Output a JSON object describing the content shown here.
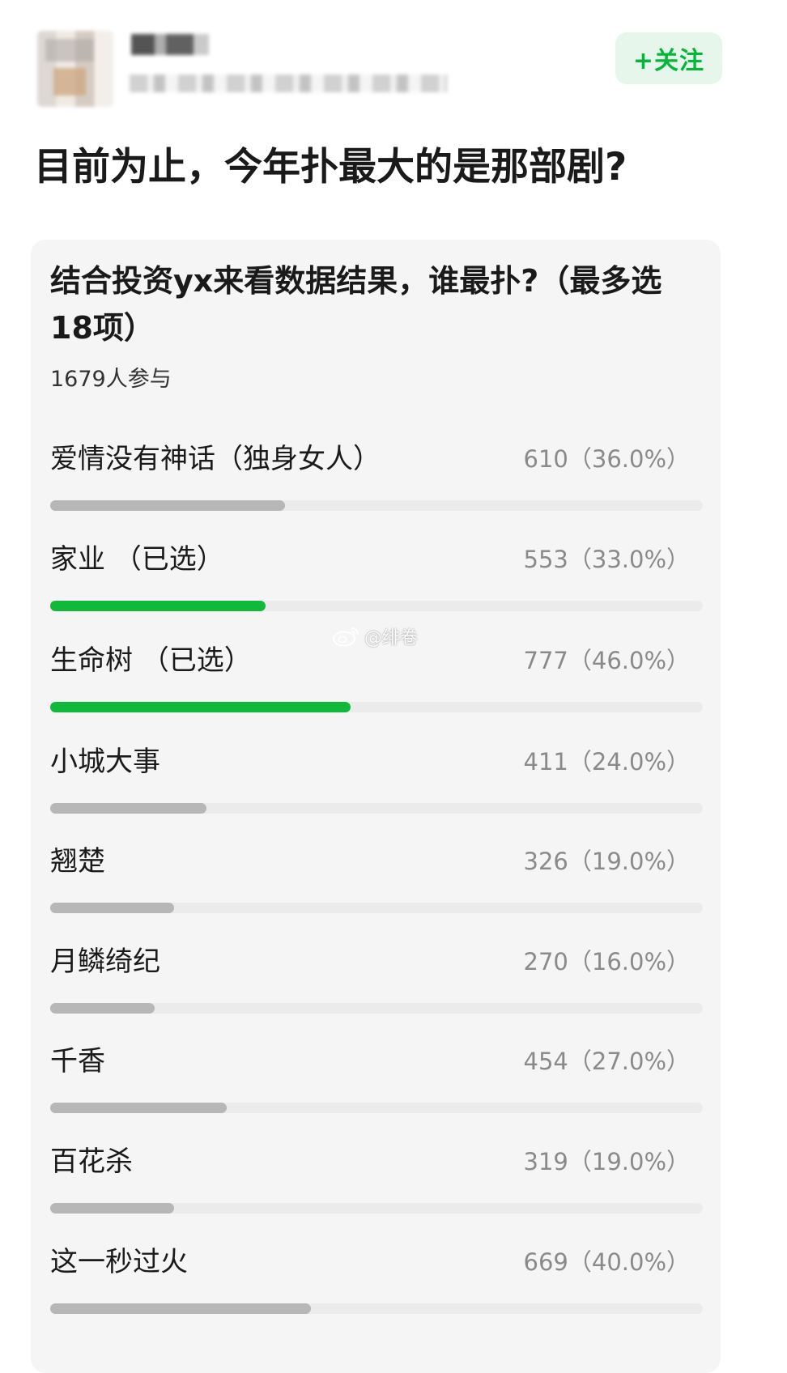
{
  "header": {
    "follow_label": "+关注"
  },
  "post": {
    "title": "目前为止，今年扑最大的是那部剧?"
  },
  "poll": {
    "question": "结合投资yx来看数据结果，谁最扑?（最多选18项）",
    "participants": "1679人参与",
    "options": [
      {
        "label": "爱情没有神话（独身女人）",
        "result": "610（36.0%）",
        "votes": 610,
        "percent": 36.0,
        "selected": false
      },
      {
        "label": "家业 （已选）",
        "result": "553（33.0%）",
        "votes": 553,
        "percent": 33.0,
        "selected": true
      },
      {
        "label": "生命树 （已选）",
        "result": "777（46.0%）",
        "votes": 777,
        "percent": 46.0,
        "selected": true
      },
      {
        "label": "小城大事",
        "result": "411（24.0%）",
        "votes": 411,
        "percent": 24.0,
        "selected": false
      },
      {
        "label": "翘楚",
        "result": "326（19.0%）",
        "votes": 326,
        "percent": 19.0,
        "selected": false
      },
      {
        "label": "月鳞绮纪",
        "result": "270（16.0%）",
        "votes": 270,
        "percent": 16.0,
        "selected": false
      },
      {
        "label": "千香",
        "result": "454（27.0%）",
        "votes": 454,
        "percent": 27.0,
        "selected": false
      },
      {
        "label": "百花杀",
        "result": "319（19.0%）",
        "votes": 319,
        "percent": 19.0,
        "selected": false
      },
      {
        "label": "这一秒过火",
        "result": "669（40.0%）",
        "votes": 669,
        "percent": 40.0,
        "selected": false
      }
    ]
  },
  "watermark": {
    "text": "@绯卷",
    "icon": "weibo-icon"
  },
  "colors": {
    "accent_green": "#10b93a",
    "bar_gray": "#b7b7b7",
    "card_background": "#f5f5f5"
  }
}
